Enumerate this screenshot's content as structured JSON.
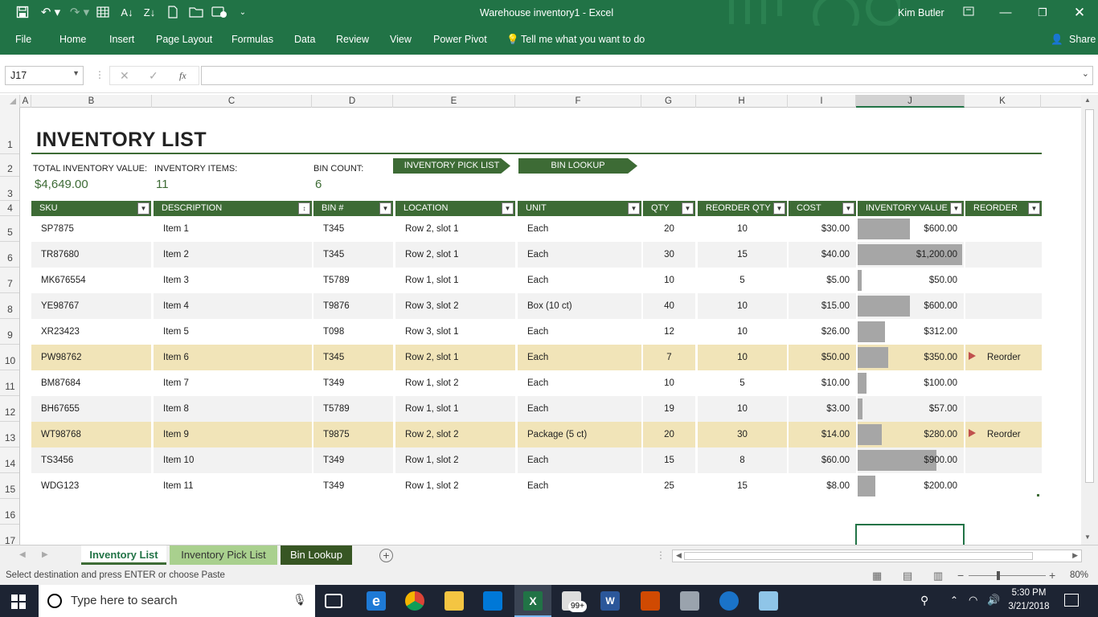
{
  "window": {
    "title": "Warehouse inventory1  -  Excel",
    "user": "Kim Butler",
    "share": "Share"
  },
  "menu": {
    "items": [
      "File",
      "Home",
      "Insert",
      "Page Layout",
      "Formulas",
      "Data",
      "Review",
      "View",
      "Power Pivot"
    ],
    "tell_me": "Tell me what you want to do"
  },
  "formula_bar": {
    "name_box": "J17",
    "fx": "fx",
    "value": ""
  },
  "columns": [
    "A",
    "B",
    "C",
    "D",
    "E",
    "F",
    "G",
    "H",
    "I",
    "J",
    "K"
  ],
  "rows": [
    "1",
    "2",
    "3",
    "4",
    "5",
    "6",
    "7",
    "8",
    "9",
    "10",
    "11",
    "12",
    "13",
    "14",
    "15",
    "16",
    "17"
  ],
  "sheet": {
    "title": "INVENTORY LIST",
    "total_label": "TOTAL INVENTORY VALUE:",
    "total_value": "$4,649.00",
    "items_label": "INVENTORY ITEMS:",
    "items_value": "11",
    "bin_label": "BIN COUNT:",
    "bin_value": "6",
    "btn_pick": "INVENTORY PICK LIST",
    "btn_bin": "BIN LOOKUP"
  },
  "table": {
    "headers": [
      "SKU",
      "DESCRIPTION",
      "BIN #",
      "LOCATION",
      "UNIT",
      "QTY",
      "REORDER QTY",
      "COST",
      "INVENTORY VALUE",
      "REORDER"
    ],
    "rows": [
      {
        "sku": "SP7875",
        "desc": "Item 1",
        "bin": "T345",
        "loc": "Row 2, slot 1",
        "unit": "Each",
        "qty": "20",
        "rqty": "10",
        "cost": "$30.00",
        "value": "$600.00",
        "value_num": 600,
        "reorder": "",
        "flag": false
      },
      {
        "sku": "TR87680",
        "desc": "Item 2",
        "bin": "T345",
        "loc": "Row 2, slot 1",
        "unit": "Each",
        "qty": "30",
        "rqty": "15",
        "cost": "$40.00",
        "value": "$1,200.00",
        "value_num": 1200,
        "reorder": "",
        "flag": false
      },
      {
        "sku": "MK676554",
        "desc": "Item 3",
        "bin": "T5789",
        "loc": "Row 1, slot 1",
        "unit": "Each",
        "qty": "10",
        "rqty": "5",
        "cost": "$5.00",
        "value": "$50.00",
        "value_num": 50,
        "reorder": "",
        "flag": false
      },
      {
        "sku": "YE98767",
        "desc": "Item 4",
        "bin": "T9876",
        "loc": "Row 3, slot 2",
        "unit": "Box (10 ct)",
        "qty": "40",
        "rqty": "10",
        "cost": "$15.00",
        "value": "$600.00",
        "value_num": 600,
        "reorder": "",
        "flag": false
      },
      {
        "sku": "XR23423",
        "desc": "Item 5",
        "bin": "T098",
        "loc": "Row 3, slot 1",
        "unit": "Each",
        "qty": "12",
        "rqty": "10",
        "cost": "$26.00",
        "value": "$312.00",
        "value_num": 312,
        "reorder": "",
        "flag": false
      },
      {
        "sku": "PW98762",
        "desc": "Item 6",
        "bin": "T345",
        "loc": "Row 2, slot 1",
        "unit": "Each",
        "qty": "7",
        "rqty": "10",
        "cost": "$50.00",
        "value": "$350.00",
        "value_num": 350,
        "reorder": "Reorder",
        "flag": true
      },
      {
        "sku": "BM87684",
        "desc": "Item 7",
        "bin": "T349",
        "loc": "Row 1, slot 2",
        "unit": "Each",
        "qty": "10",
        "rqty": "5",
        "cost": "$10.00",
        "value": "$100.00",
        "value_num": 100,
        "reorder": "",
        "flag": false
      },
      {
        "sku": "BH67655",
        "desc": "Item 8",
        "bin": "T5789",
        "loc": "Row 1, slot 1",
        "unit": "Each",
        "qty": "19",
        "rqty": "10",
        "cost": "$3.00",
        "value": "$57.00",
        "value_num": 57,
        "reorder": "",
        "flag": false
      },
      {
        "sku": "WT98768",
        "desc": "Item 9",
        "bin": "T9875",
        "loc": "Row 2, slot 2",
        "unit": "Package (5 ct)",
        "qty": "20",
        "rqty": "30",
        "cost": "$14.00",
        "value": "$280.00",
        "value_num": 280,
        "reorder": "Reorder",
        "flag": true
      },
      {
        "sku": "TS3456",
        "desc": "Item 10",
        "bin": "T349",
        "loc": "Row 1, slot 2",
        "unit": "Each",
        "qty": "15",
        "rqty": "8",
        "cost": "$60.00",
        "value": "$900.00",
        "value_num": 900,
        "reorder": "",
        "flag": false
      },
      {
        "sku": "WDG123",
        "desc": "Item 11",
        "bin": "T349",
        "loc": "Row 1, slot 2",
        "unit": "Each",
        "qty": "25",
        "rqty": "15",
        "cost": "$8.00",
        "value": "$200.00",
        "value_num": 200,
        "reorder": "",
        "flag": false
      }
    ]
  },
  "tabs": [
    "Inventory List",
    "Inventory Pick List",
    "Bin Lookup"
  ],
  "status": {
    "text": "Select destination and press ENTER or choose Paste",
    "zoom": "80%"
  },
  "taskbar": {
    "search": "Type here to search",
    "time": "5:30 PM",
    "date": "3/21/2018",
    "badge": "99+"
  },
  "colors": {
    "excel_green": "#217346",
    "header_green": "#3d6b35",
    "highlight": "#f1e4b8",
    "stripe": "#f2f2f2",
    "bar": "#a6a6a6",
    "flag": "#c0504d"
  }
}
